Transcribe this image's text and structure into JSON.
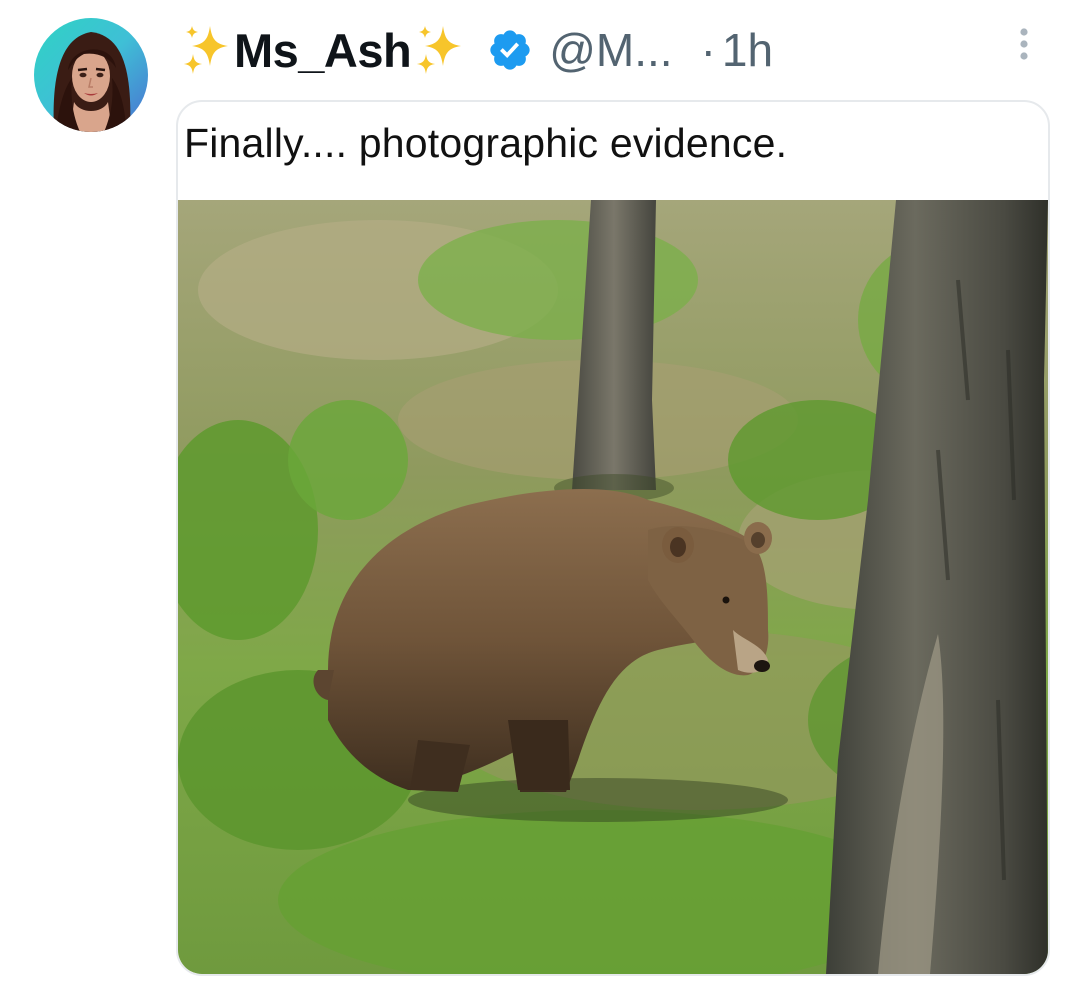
{
  "tweet": {
    "author": {
      "display_name": "Ms_Ash",
      "name_decoration": "sparkles-emoji",
      "handle": "@M...",
      "verified": true,
      "avatar": "avatar-photo"
    },
    "separator": "·",
    "time": "1h",
    "more_icon": "ellipsis-vertical-icon",
    "media": {
      "caption": "Finally.... photographic evidence.",
      "image": "bear-in-forest-photo"
    }
  },
  "colors": {
    "verified_blue": "#1d9bf0",
    "secondary_text": "#536471",
    "sparkle_gold": "#f7c52b"
  }
}
